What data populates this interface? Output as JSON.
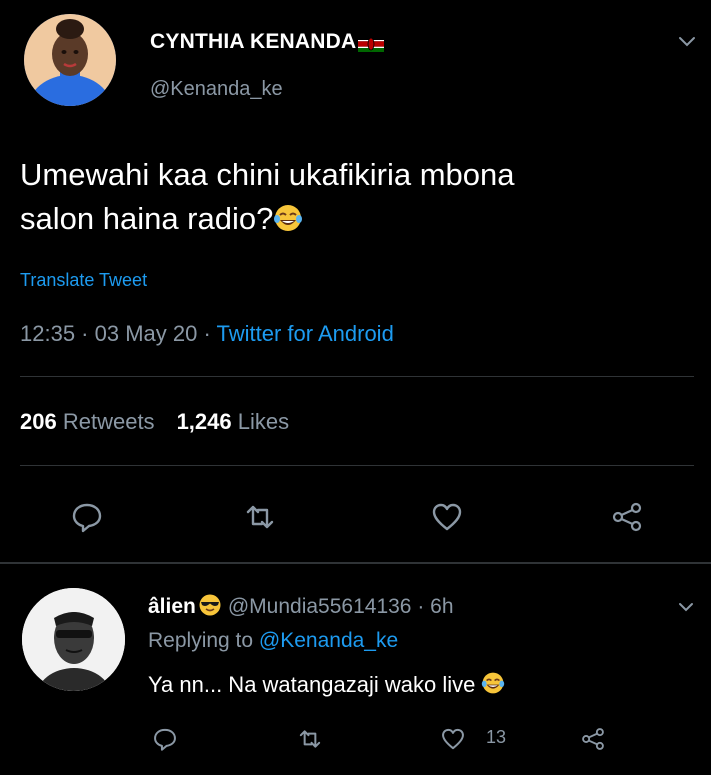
{
  "main_tweet": {
    "display_name": "CYNTHIA KENANDA",
    "handle": "@Kenanda_ke",
    "text_line1": "Umewahi kaa chini ukafikiria mbona",
    "text_line2": "salon haina radio?",
    "translate_label": "Translate Tweet",
    "timestamp": "12:35 · 03 May 20 · ",
    "source": "Twitter for Android",
    "retweets_count": "206",
    "retweets_label": "Retweets",
    "likes_count": "1,246",
    "likes_label": "Likes"
  },
  "reply": {
    "display_name": "âlien",
    "handle_time": "@Mundia55614136 · 6h",
    "replying_prefix": "Replying to ",
    "replying_to": "@Kenanda_ke",
    "text": "Ya nn... Na watangazaji wako live",
    "like_count": "13"
  },
  "icons": {
    "reply": "comment-bubble-icon",
    "retweet": "retweet-icon",
    "like": "heart-icon",
    "share": "share-icon",
    "menu": "chevron-down-icon",
    "flag": "kenya-flag-icon",
    "emoji_laugh": "tears-of-joy-emoji",
    "emoji_cool": "sunglasses-emoji"
  },
  "colors": {
    "background": "#000000",
    "text_primary": "#ffffff",
    "text_secondary": "#8b98a5",
    "link": "#1d9bf0",
    "divider": "#2f3336"
  }
}
